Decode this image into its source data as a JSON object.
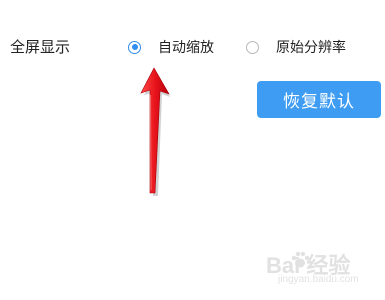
{
  "display_setting": {
    "label": "全屏显示",
    "options": [
      {
        "label": "自动缩放",
        "selected": true
      },
      {
        "label": "原始分辨率",
        "selected": false
      }
    ],
    "restore_label": "恢复默认"
  },
  "annotation": {
    "arrow_color": "#ee1c24"
  },
  "watermark": {
    "brand": "Bai  经验",
    "url": "jingyan.baidu.com"
  },
  "colors": {
    "accent": "#3e9cf2",
    "radio_checked": "#2f8ef0"
  }
}
